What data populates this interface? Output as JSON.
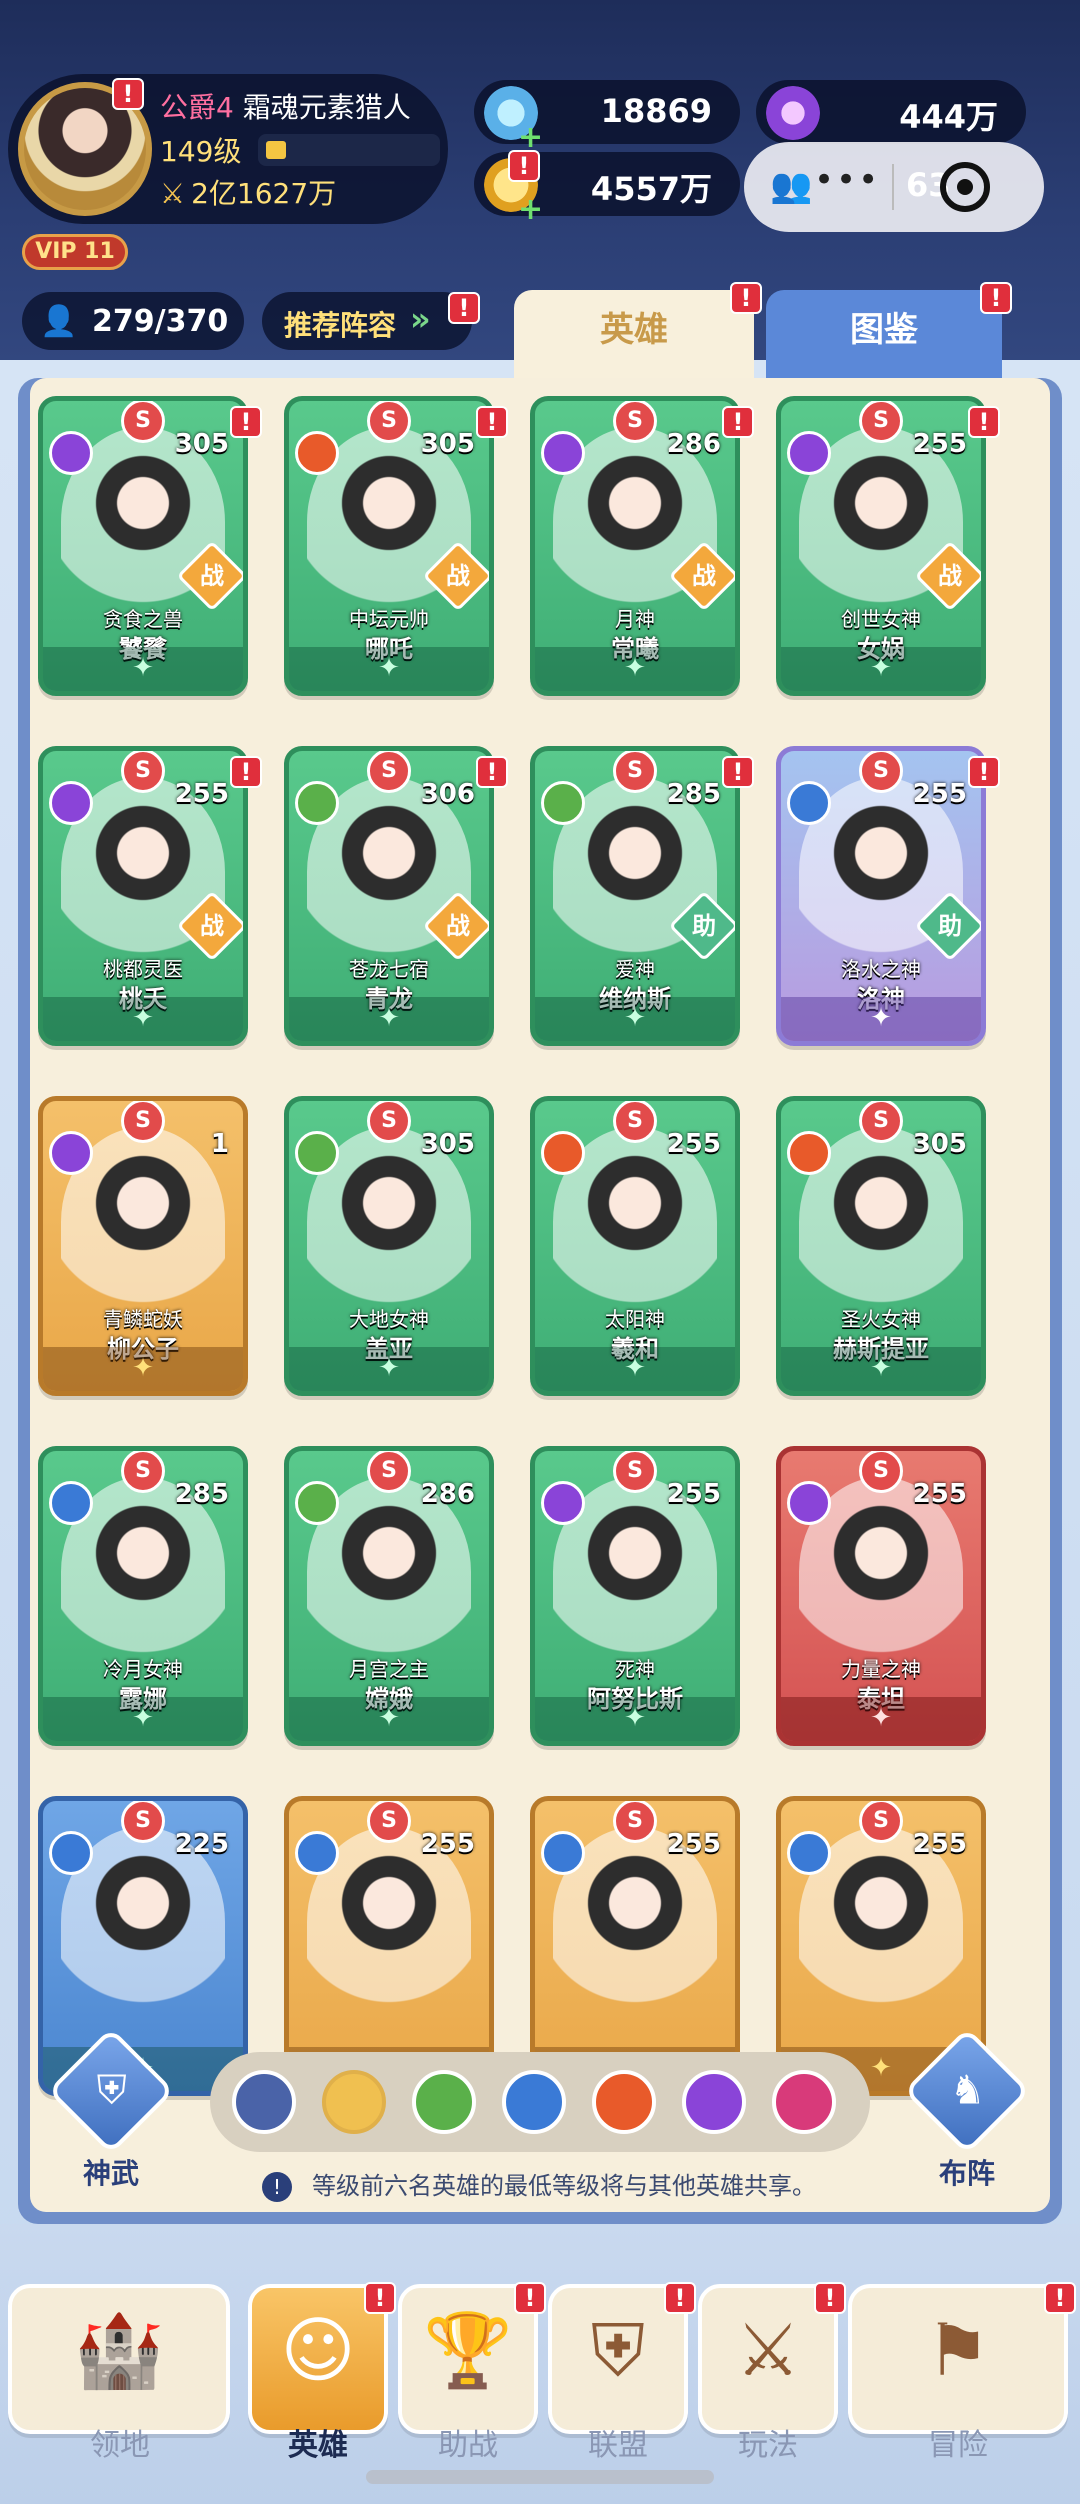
{
  "player": {
    "rank": "公爵4",
    "title": "霜魂元素猎人",
    "level": "149级",
    "power": "2亿1627万",
    "vip": "VIP 11"
  },
  "resources": {
    "gems": "18869",
    "gold": "4557万",
    "purple": "444万",
    "online_partial": "63"
  },
  "roster": {
    "count": "279/370",
    "recommend": "推荐阵容"
  },
  "tabs": {
    "heroes": "英雄",
    "atlas": "图鉴"
  },
  "heroes": [
    {
      "title": "贪食之兽",
      "name": "饕餮",
      "level": "305",
      "role": "战",
      "theme": "green",
      "element": "#8a44d8"
    },
    {
      "title": "中坛元帅",
      "name": "哪吒",
      "level": "305",
      "role": "战",
      "theme": "green",
      "element": "#e85a2a"
    },
    {
      "title": "月神",
      "name": "常曦",
      "level": "286",
      "role": "战",
      "theme": "green",
      "element": "#8a44d8"
    },
    {
      "title": "创世女神",
      "name": "女娲",
      "level": "255",
      "role": "战",
      "theme": "green",
      "element": "#8a44d8"
    },
    {
      "title": "桃都灵医",
      "name": "桃夭",
      "level": "255",
      "role": "战",
      "theme": "green",
      "element": "#8a44d8"
    },
    {
      "title": "苍龙七宿",
      "name": "青龙",
      "level": "306",
      "role": "战",
      "theme": "green",
      "element": "#5ab04a"
    },
    {
      "title": "爱神",
      "name": "维纳斯",
      "level": "285",
      "role": "助",
      "theme": "green",
      "element": "#5ab04a"
    },
    {
      "title": "洛水之神",
      "name": "洛神",
      "level": "255",
      "role": "助",
      "theme": "ice",
      "element": "#3a7ad6"
    },
    {
      "title": "青鳞蛇妖",
      "name": "柳公子",
      "level": "1",
      "role": "",
      "theme": "gold",
      "element": "#8a44d8"
    },
    {
      "title": "大地女神",
      "name": "盖亚",
      "level": "305",
      "role": "",
      "theme": "green",
      "element": "#5ab04a"
    },
    {
      "title": "太阳神",
      "name": "羲和",
      "level": "255",
      "role": "",
      "theme": "green",
      "element": "#e85a2a"
    },
    {
      "title": "圣火女神",
      "name": "赫斯提亚",
      "level": "305",
      "role": "",
      "theme": "green",
      "element": "#e85a2a"
    },
    {
      "title": "冷月女神",
      "name": "露娜",
      "level": "285",
      "role": "",
      "theme": "green",
      "element": "#3a7ad6"
    },
    {
      "title": "月宫之主",
      "name": "嫦娥",
      "level": "286",
      "role": "",
      "theme": "green",
      "element": "#5ab04a"
    },
    {
      "title": "死神",
      "name": "阿努比斯",
      "level": "255",
      "role": "",
      "theme": "green",
      "element": "#8a44d8"
    },
    {
      "title": "力量之神",
      "name": "泰坦",
      "level": "255",
      "role": "",
      "theme": "red",
      "element": "#8a44d8"
    },
    {
      "title": "",
      "name": "",
      "level": "225",
      "role": "",
      "theme": "blue",
      "element": "#3a7ad6"
    },
    {
      "title": "",
      "name": "",
      "level": "255",
      "role": "",
      "theme": "gold",
      "element": "#3a7ad6"
    },
    {
      "title": "",
      "name": "",
      "level": "255",
      "role": "",
      "theme": "gold",
      "element": "#3a7ad6"
    },
    {
      "title": "",
      "name": "",
      "level": "255",
      "role": "",
      "theme": "gold",
      "element": "#3a7ad6"
    }
  ],
  "filters": {
    "colors": [
      "#4a63a8",
      "#f0c050",
      "#5ab04a",
      "#3a7ad6",
      "#e85a2a",
      "#8a44d8",
      "#d83a7a"
    ]
  },
  "bottom_tools": {
    "shenwu": "神武",
    "buzhen": "布阵"
  },
  "note": "等级前六名英雄的最低等级将与其他英雄共享。",
  "nav": [
    {
      "label": "领地",
      "icon": "castle-icon"
    },
    {
      "label": "英雄",
      "icon": "hero-icon"
    },
    {
      "label": "助战",
      "icon": "assist-icon"
    },
    {
      "label": "联盟",
      "icon": "alliance-icon"
    },
    {
      "label": "玩法",
      "icon": "gameplay-icon"
    },
    {
      "label": "冒险",
      "icon": "adventure-icon"
    }
  ]
}
